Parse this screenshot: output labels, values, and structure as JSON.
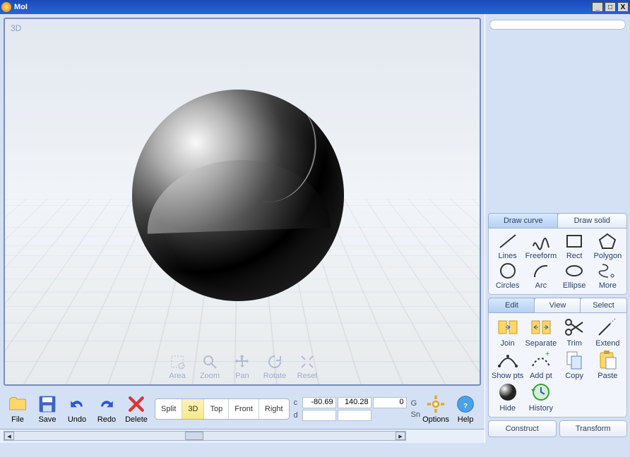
{
  "window": {
    "title": "MoI"
  },
  "viewport": {
    "label": "3D"
  },
  "viewTools": [
    {
      "name": "area",
      "label": "Area"
    },
    {
      "name": "zoom",
      "label": "Zoom"
    },
    {
      "name": "pan",
      "label": "Pan"
    },
    {
      "name": "rotate",
      "label": "Rotate"
    },
    {
      "name": "reset",
      "label": "Reset"
    }
  ],
  "bottom": {
    "buttons": [
      {
        "name": "file",
        "label": "File"
      },
      {
        "name": "save",
        "label": "Save"
      },
      {
        "name": "undo",
        "label": "Undo"
      },
      {
        "name": "redo",
        "label": "Redo"
      },
      {
        "name": "delete",
        "label": "Delete"
      }
    ],
    "views": [
      {
        "name": "split",
        "label": "Split"
      },
      {
        "name": "3d",
        "label": "3D",
        "active": true
      },
      {
        "name": "top",
        "label": "Top"
      },
      {
        "name": "front",
        "label": "Front"
      },
      {
        "name": "right",
        "label": "Right"
      }
    ],
    "coordTopLabel": "c",
    "coordBotLabel": "d",
    "coords": {
      "x": "-80.69",
      "y": "140.28",
      "z": "0"
    },
    "grid": "G",
    "snap": "Sn",
    "options": "Options",
    "help": "Help"
  },
  "drawTabs": [
    {
      "name": "draw-curve",
      "label": "Draw curve",
      "active": true
    },
    {
      "name": "draw-solid",
      "label": "Draw solid"
    }
  ],
  "drawTools": [
    {
      "name": "lines",
      "label": "Lines"
    },
    {
      "name": "freeform",
      "label": "Freeform"
    },
    {
      "name": "rect",
      "label": "Rect"
    },
    {
      "name": "polygon",
      "label": "Polygon"
    },
    {
      "name": "circles",
      "label": "Circles"
    },
    {
      "name": "arc",
      "label": "Arc"
    },
    {
      "name": "ellipse",
      "label": "Ellipse"
    },
    {
      "name": "more",
      "label": "More"
    }
  ],
  "editTabs": [
    {
      "name": "edit",
      "label": "Edit",
      "active": true
    },
    {
      "name": "view",
      "label": "View"
    },
    {
      "name": "select",
      "label": "Select"
    }
  ],
  "editTools": [
    {
      "name": "join",
      "label": "Join"
    },
    {
      "name": "separate",
      "label": "Separate"
    },
    {
      "name": "trim",
      "label": "Trim"
    },
    {
      "name": "extend",
      "label": "Extend"
    },
    {
      "name": "showpts",
      "label": "Show pts"
    },
    {
      "name": "addpt",
      "label": "Add pt"
    },
    {
      "name": "copy",
      "label": "Copy"
    },
    {
      "name": "paste",
      "label": "Paste"
    },
    {
      "name": "hide",
      "label": "Hide"
    },
    {
      "name": "history",
      "label": "History"
    }
  ],
  "actions": [
    {
      "name": "construct",
      "label": "Construct"
    },
    {
      "name": "transform",
      "label": "Transform"
    }
  ]
}
